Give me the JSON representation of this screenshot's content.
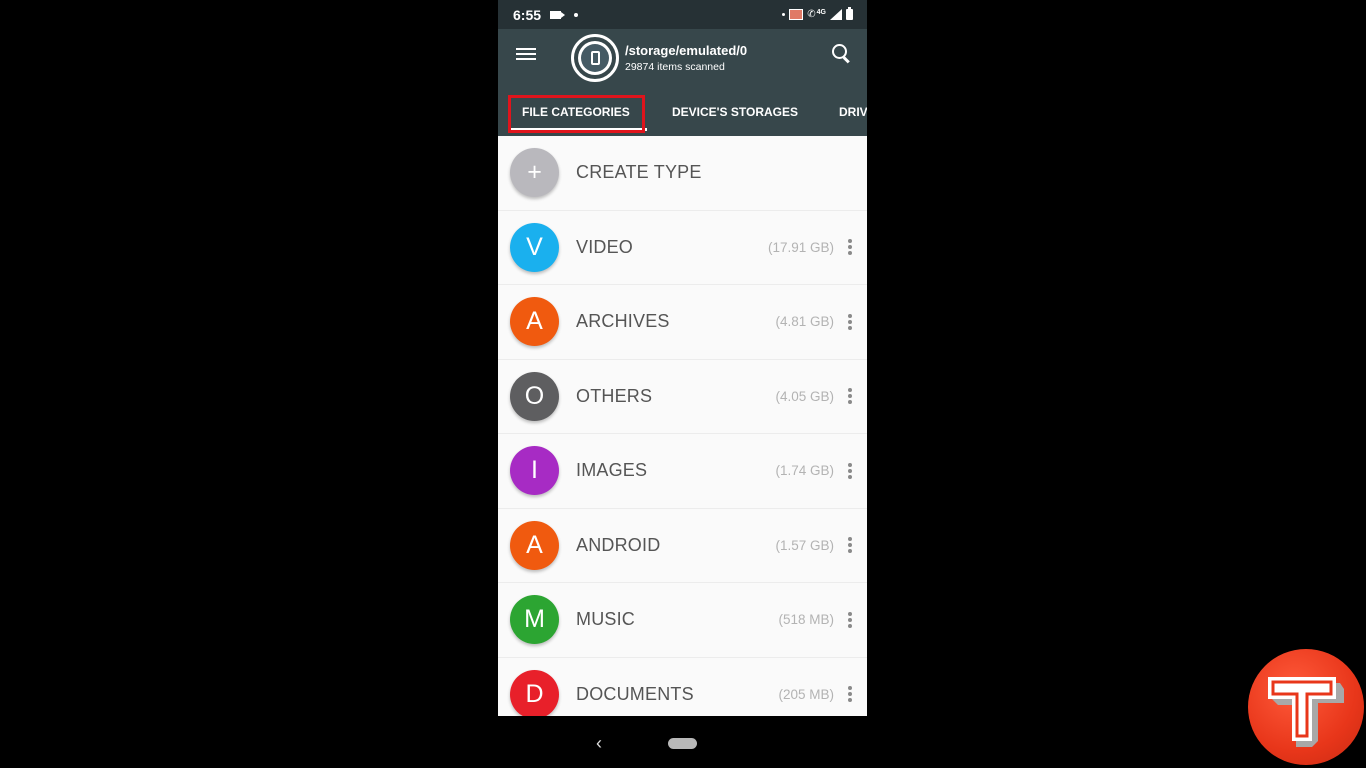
{
  "status_bar": {
    "time": "6:55",
    "left_icons": [
      "video-record-icon",
      "notification-dot-icon"
    ],
    "right_icons": [
      "cast-icon",
      "wifi-call-icon",
      "network-4g-icon",
      "signal-icon",
      "battery-icon"
    ],
    "network_label": "4G"
  },
  "app_bar": {
    "menu_icon": "hamburger-menu-icon",
    "storage_path": "/storage/emulated/0",
    "items_scanned": "29874 items scanned",
    "search_icon": "search-icon"
  },
  "tabs": [
    {
      "label": "FILE CATEGORIES",
      "selected": true,
      "highlighted": true
    },
    {
      "label": "DEVICE'S STORAGES",
      "selected": false
    },
    {
      "label": "DRIV",
      "selected": false
    }
  ],
  "categories": [
    {
      "letter": "+",
      "label": "CREATE TYPE",
      "size": "",
      "color": "#b9b8bd",
      "has_menu": false
    },
    {
      "letter": "V",
      "label": "VIDEO",
      "size": "(17.91 GB)",
      "color": "#1ab0ee",
      "has_menu": true
    },
    {
      "letter": "A",
      "label": "ARCHIVES",
      "size": "(4.81 GB)",
      "color": "#f05a0f",
      "has_menu": true
    },
    {
      "letter": "O",
      "label": "OTHERS",
      "size": "(4.05 GB)",
      "color": "#5e5e60",
      "has_menu": true
    },
    {
      "letter": "I",
      "label": "IMAGES",
      "size": "(1.74 GB)",
      "color": "#a72bc4",
      "has_menu": true
    },
    {
      "letter": "A",
      "label": "ANDROID",
      "size": "(1.57 GB)",
      "color": "#f05a0f",
      "has_menu": true
    },
    {
      "letter": "M",
      "label": "MUSIC",
      "size": "(518 MB)",
      "color": "#2ca532",
      "has_menu": true
    },
    {
      "letter": "D",
      "label": "DOCUMENTS",
      "size": "(205 MB)",
      "color": "#e8202a",
      "has_menu": true
    }
  ],
  "nav_bar": {
    "back_icon": "‹",
    "home_icon": "home-pill-icon"
  },
  "watermark": {
    "letter": "T",
    "color": "#e8361a"
  },
  "colors": {
    "status_bar_bg": "#263135",
    "app_bar_bg": "#37474b",
    "highlight_box": "#e0141c",
    "list_bg": "#fafafa"
  }
}
